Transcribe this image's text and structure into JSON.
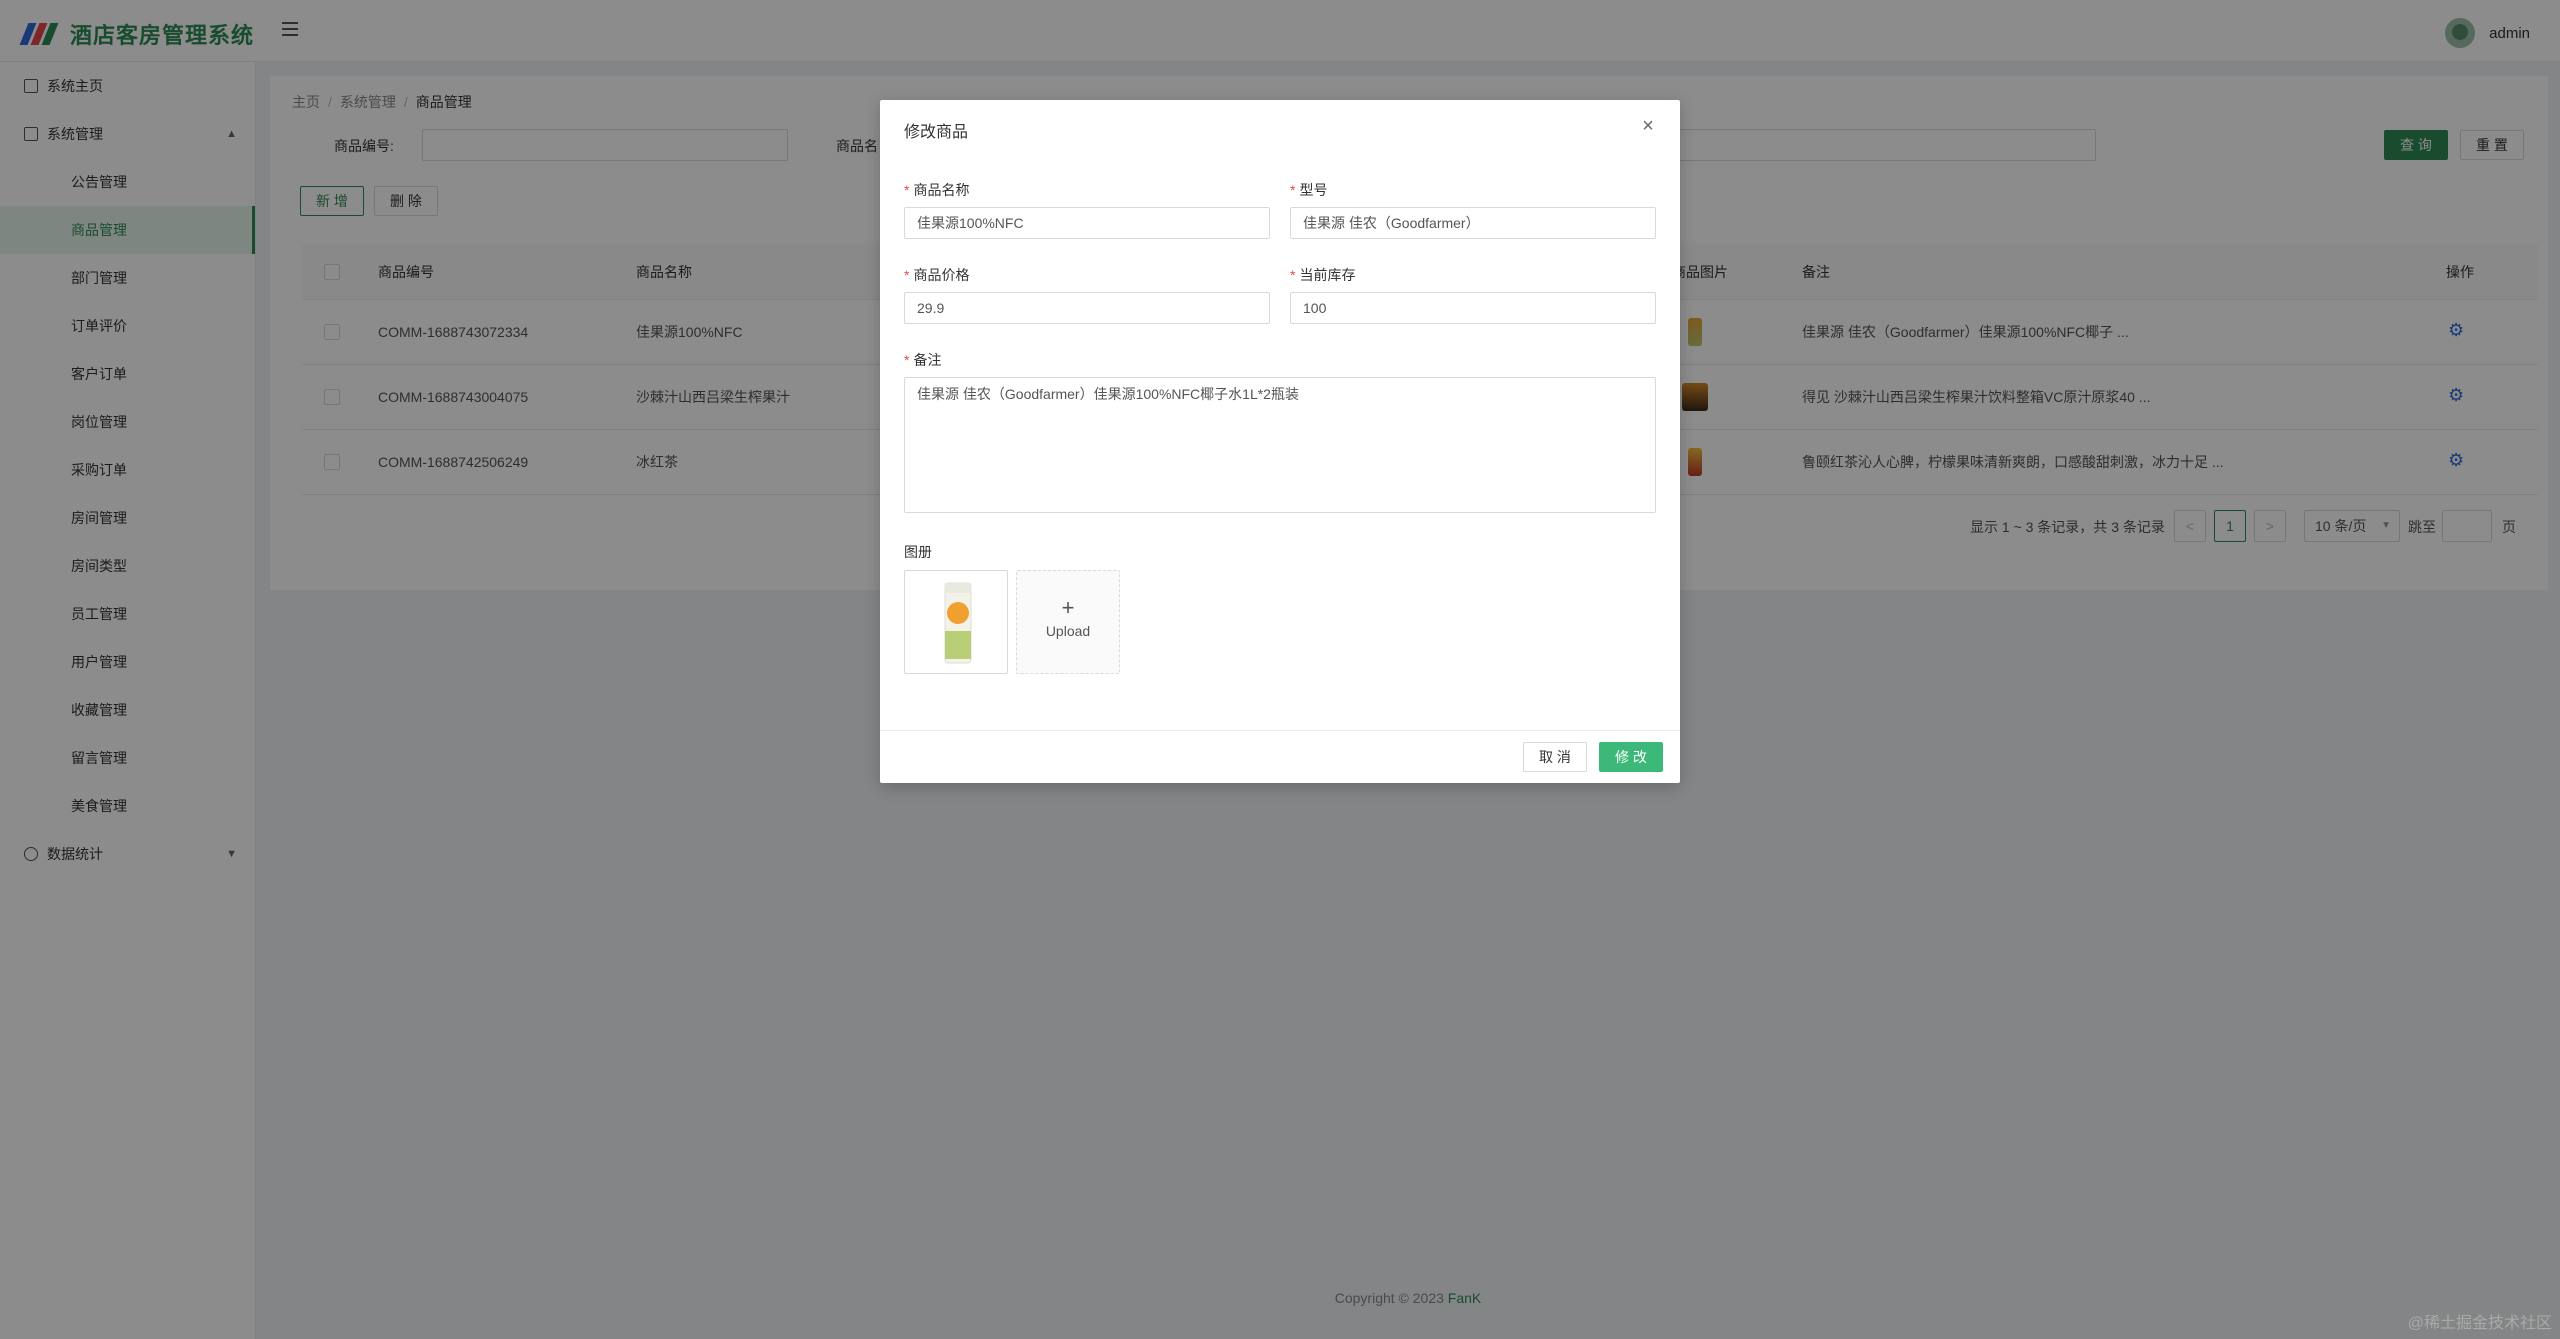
{
  "app": {
    "title": "酒店客房管理系统",
    "user": "admin",
    "colors": {
      "accent": "#2e8b57",
      "logo_red": "#e5484d",
      "logo_blue": "#2e6bd8",
      "logo_green": "#2e8b57"
    }
  },
  "sidebar": {
    "home": "系统主页",
    "system": "系统管理",
    "system_items": [
      "公告管理",
      "商品管理",
      "部门管理",
      "订单评价",
      "客户订单",
      "岗位管理",
      "采购订单",
      "房间管理",
      "房间类型",
      "员工管理",
      "用户管理",
      "收藏管理",
      "留言管理",
      "美食管理"
    ],
    "active_index": 1,
    "stats": "数据统计"
  },
  "breadcrumb": [
    "主页",
    "系统管理",
    "商品管理"
  ],
  "filters": {
    "code_label": "商品编号:",
    "name_label": "商品名",
    "search": "查 询",
    "reset": "重 置"
  },
  "actions": {
    "add": "新 增",
    "delete": "删 除"
  },
  "table": {
    "headers": [
      "商品编号",
      "商品名称",
      "商品图片",
      "备注",
      "操作"
    ],
    "rows": [
      {
        "code": "COMM-1688743072334",
        "name": "佳果源100%NFC",
        "remark": "佳果源 佳农（Goodfarmer）佳果源100%NFC椰子 ..."
      },
      {
        "code": "COMM-1688743004075",
        "name": "沙棘汁山西吕梁生榨果汁",
        "remark": "得见 沙棘汁山西吕梁生榨果汁饮料整箱VC原汁原浆40 ..."
      },
      {
        "code": "COMM-1688742506249",
        "name": "冰红茶",
        "remark": "鲁颐红茶沁人心脾，柠檬果味清新爽朗，口感酸甜刺激，冰力十足 ..."
      }
    ]
  },
  "pagination": {
    "summary": "显示 1 ~ 3 条记录，共 3 条记录",
    "prev": "<",
    "current": "1",
    "next": ">",
    "page_size": "10 条/页",
    "jump_label": "跳至",
    "page_unit": "页"
  },
  "footer": {
    "copyright": "Copyright © 2023 ",
    "brand": "FanK"
  },
  "modal": {
    "title": "修改商品",
    "close": "×",
    "fields": {
      "name_label": "商品名称",
      "name_value": "佳果源100%NFC",
      "model_label": "型号",
      "model_value": "佳果源 佳农（Goodfarmer）",
      "price_label": "商品价格",
      "price_value": "29.9",
      "stock_label": "当前库存",
      "stock_value": "100",
      "remark_label": "备注",
      "remark_value": "佳果源 佳农（Goodfarmer）佳果源100%NFC椰子水1L*2瓶装",
      "album_label": "图册"
    },
    "upload": {
      "plus": "+",
      "text": "Upload"
    },
    "cancel": "取 消",
    "submit": "修 改"
  },
  "watermark": "@稀土掘金技术社区"
}
